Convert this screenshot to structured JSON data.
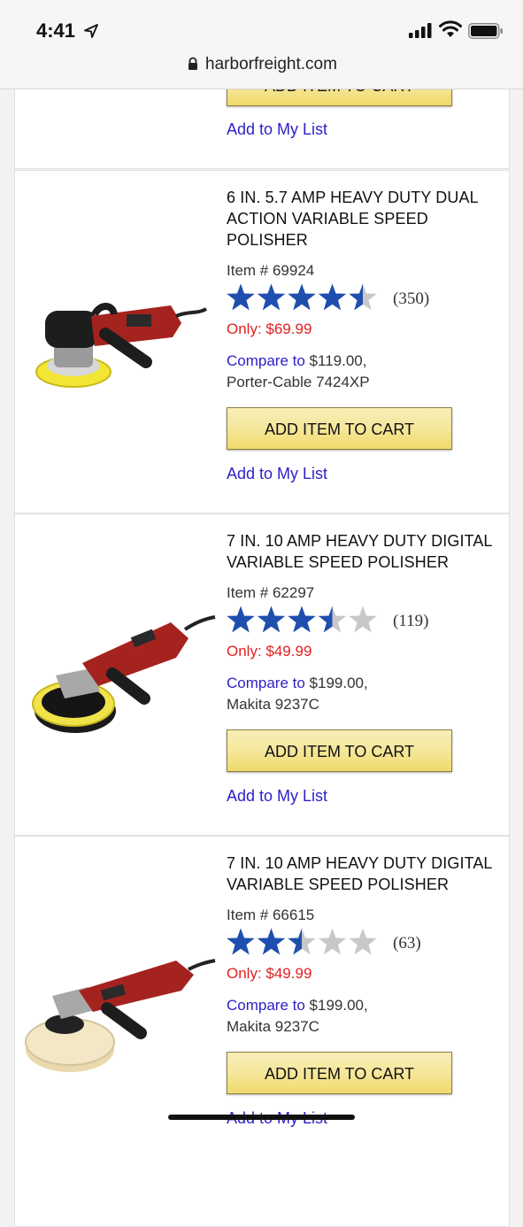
{
  "status": {
    "time": "4:41",
    "url": "harborfreight.com"
  },
  "top_card": {
    "button": "ADD ITEM TO CART",
    "list": "Add to My List"
  },
  "products": [
    {
      "title": "6 IN. 5.7 AMP HEAVY DUTY DUAL ACTION VARIABLE SPEED POLISHER",
      "item": "Item # 69924",
      "rating": 4.5,
      "reviews": "(350)",
      "price": "Only: $69.99",
      "compare_label": "Compare to",
      "compare_price": " $119.00,",
      "compare_model": "Porter-Cable 7424XP",
      "button": "ADD ITEM TO CART",
      "list": "Add to My List"
    },
    {
      "title": "7 IN. 10 AMP HEAVY DUTY DIGITAL VARIABLE SPEED POLISHER",
      "item": "Item # 62297",
      "rating": 3.5,
      "reviews": "(119)",
      "price": "Only: $49.99",
      "compare_label": "Compare to",
      "compare_price": " $199.00,",
      "compare_model": "Makita 9237C",
      "button": "ADD ITEM TO CART",
      "list": "Add to My List"
    },
    {
      "title": "7 IN. 10 AMP HEAVY DUTY DIGITAL VARIABLE SPEED POLISHER",
      "item": "Item # 66615",
      "rating": 2.5,
      "reviews": "(63)",
      "price": "Only: $49.99",
      "compare_label": "Compare to",
      "compare_price": " $199.00,",
      "compare_model": "Makita 9237C",
      "button": "ADD ITEM TO CART",
      "list": "Add to My List"
    }
  ],
  "colors": {
    "star_fill": "#1f4fae",
    "star_empty": "#c8c8c8",
    "price": "#e02222",
    "link": "#2c1fc8",
    "button": "#f5e79b"
  }
}
